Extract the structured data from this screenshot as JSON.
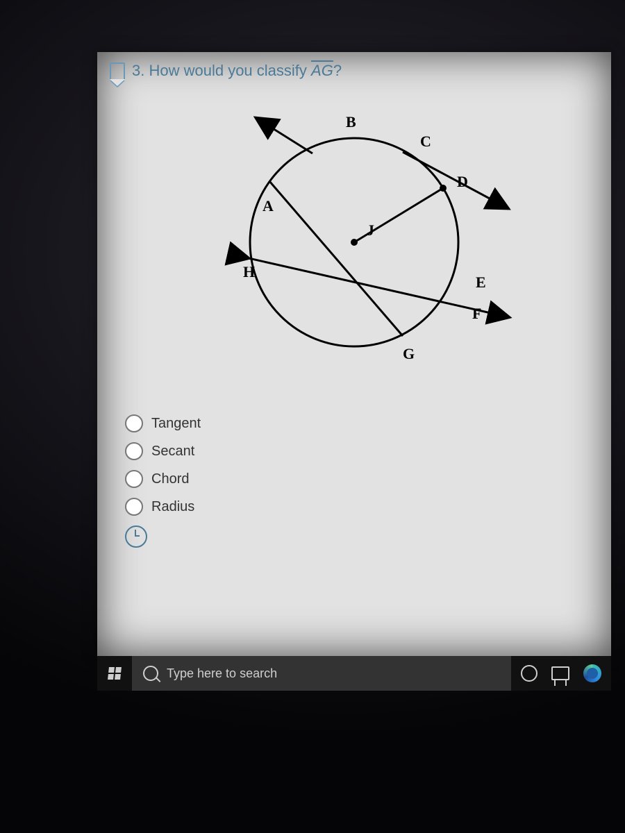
{
  "question": {
    "number": "3.",
    "prompt_prefix": "How would you classify ",
    "segment": "AG",
    "prompt_suffix": "?"
  },
  "diagram": {
    "labels": [
      "A",
      "B",
      "C",
      "D",
      "E",
      "F",
      "G",
      "H",
      "J"
    ]
  },
  "options": [
    {
      "label": "Tangent"
    },
    {
      "label": "Secant"
    },
    {
      "label": "Chord"
    },
    {
      "label": "Radius"
    }
  ],
  "taskbar": {
    "search_placeholder": "Type here to search"
  }
}
